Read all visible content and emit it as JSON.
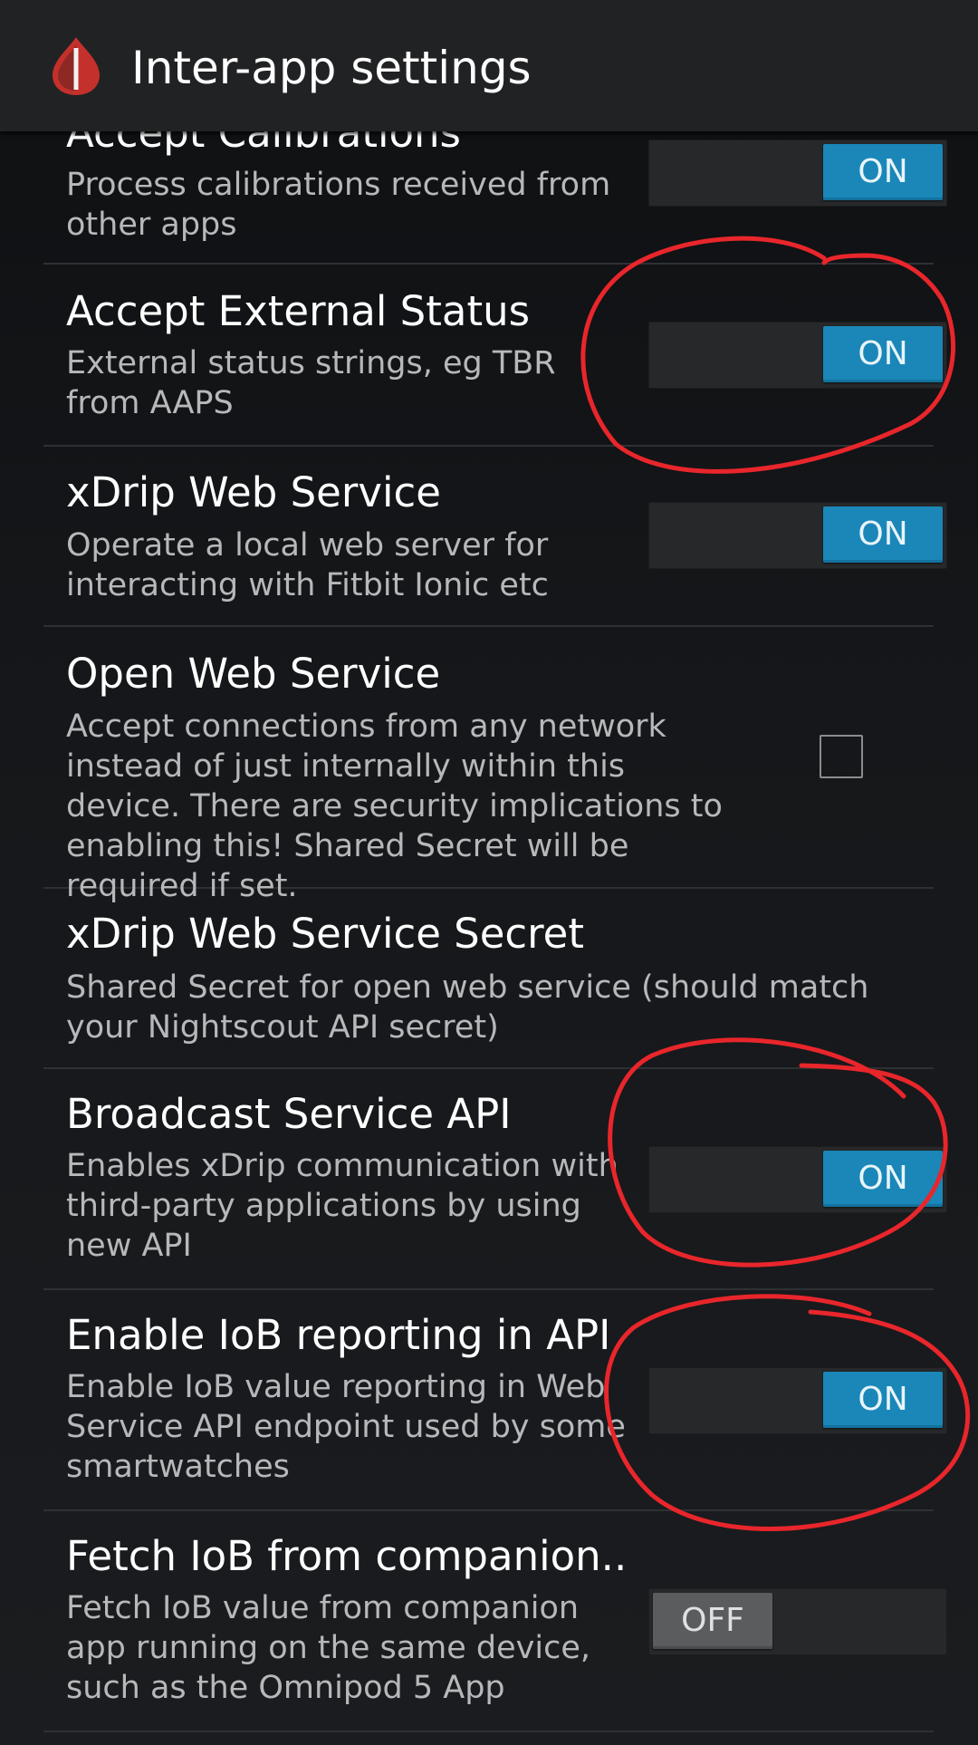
{
  "app_bar": {
    "title": "Inter-app settings",
    "icon": "blood-drop-icon",
    "accent": "#c4302b"
  },
  "preferences": [
    {
      "title": "Accept Calibrations",
      "summary": "Process calibrations received from other apps",
      "control": "switch",
      "state": "ON"
    },
    {
      "title": "Accept External Status",
      "summary": "External status strings, eg TBR from AAPS",
      "control": "switch",
      "state": "ON"
    },
    {
      "title": "xDrip Web Service",
      "summary": "Operate a local web server for interacting with Fitbit Ionic etc",
      "control": "switch",
      "state": "ON"
    },
    {
      "title": "Open Web Service",
      "summary": "Accept connections from any network instead of just internally within this device. There are security implications to enabling this! Shared Secret will be required if set.",
      "control": "checkbox",
      "checked": false
    },
    {
      "title": "xDrip Web Service Secret",
      "summary": "Shared Secret for open web service (should match your Nightscout API secret)",
      "control": "none"
    },
    {
      "title": "Broadcast Service API",
      "summary": "Enables xDrip communication with third-party applications by using new API",
      "control": "switch",
      "state": "ON"
    },
    {
      "title": "Enable IoB reporting in API",
      "summary": "Enable IoB value reporting in Web Service API endpoint used by some smartwatches",
      "control": "switch",
      "state": "ON"
    },
    {
      "title": "Fetch IoB from companion..",
      "summary": "Fetch IoB value from companion app running on the same device, such as the Omnipod 5 App",
      "control": "switch",
      "state": "OFF"
    }
  ],
  "colors": {
    "switch_on": "#1a87b8",
    "switch_off": "#5a5c5e",
    "annotation": "#e8262b",
    "divider": "#2e3134"
  }
}
